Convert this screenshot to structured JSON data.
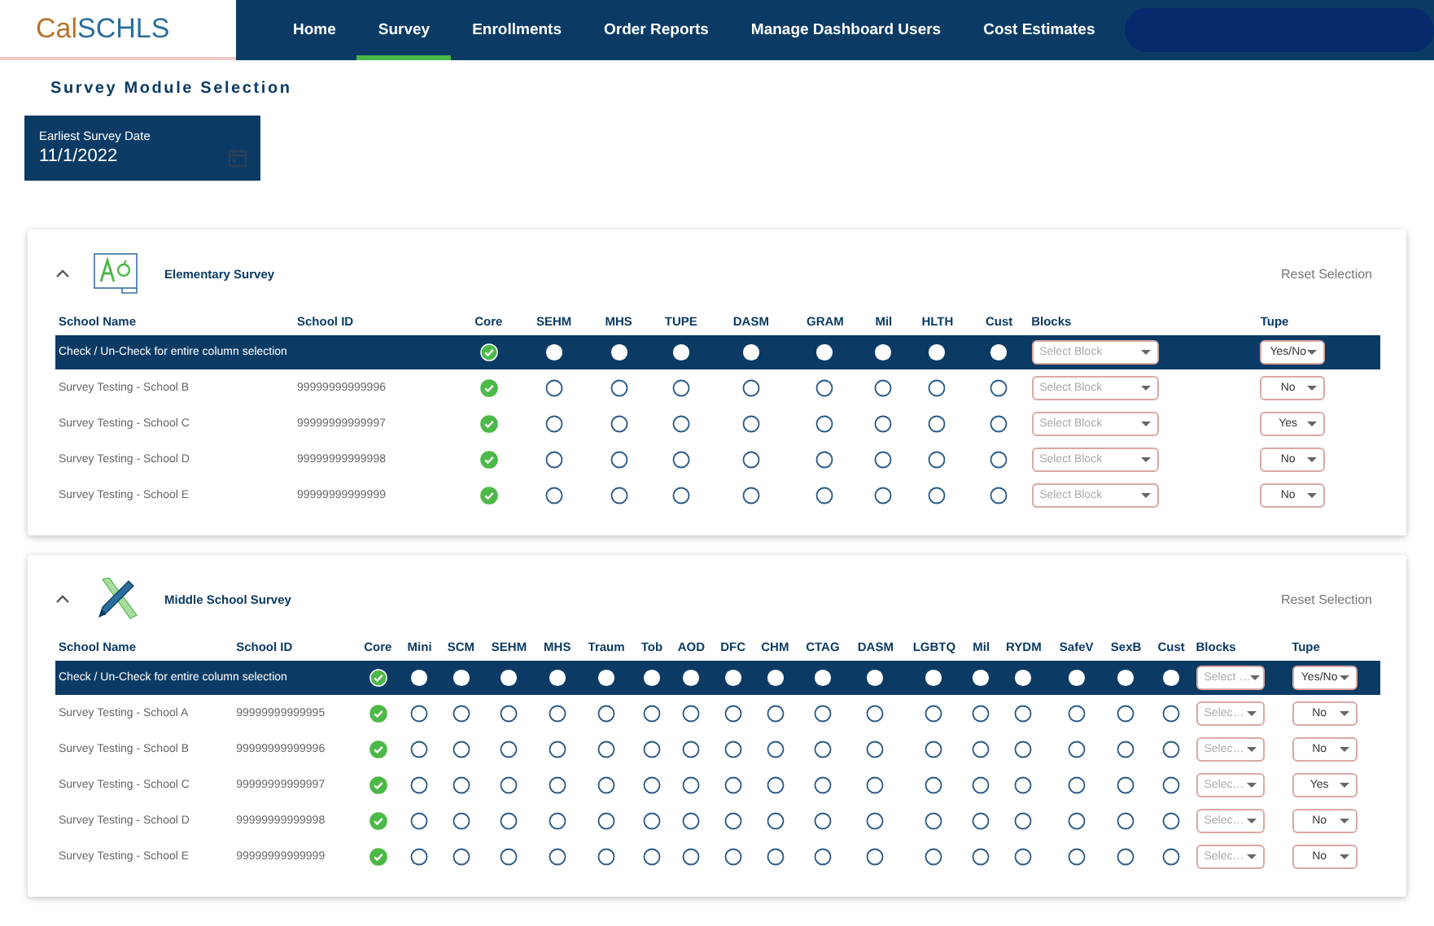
{
  "logo": {
    "part_1": "Cal",
    "part_2": "SCHLS"
  },
  "nav": [
    {
      "label": "Home",
      "selected": false
    },
    {
      "label": "Survey",
      "selected": true
    },
    {
      "label": "Enrollments",
      "selected": false
    },
    {
      "label": "Order Reports",
      "selected": false
    },
    {
      "label": "Manage Dashboard Users",
      "selected": false
    },
    {
      "label": "Cost Estimates",
      "selected": false
    }
  ],
  "page_title": "Survey Module Selection",
  "date_field": {
    "label": "Earliest Survey Date",
    "value": "11/1/2022"
  },
  "surveys": [
    {
      "title": "Elementary Survey",
      "expanded": true,
      "reset": "Reset Selection",
      "columns": {
        "name": "School Name",
        "id": "School ID",
        "modules": [
          "Core",
          "SEHM",
          "MHS",
          "TUPE",
          "DASM",
          "GRAM",
          "Mil",
          "HLTH",
          "Cust"
        ],
        "blocks": "Blocks",
        "tupe": "Tupe"
      },
      "all_row": {
        "label": "Check / Un-Check for entire column selection",
        "checks": [
          {
            "checked": true
          },
          {
            "checked": false
          },
          {
            "checked": false
          },
          {
            "checked": false
          },
          {
            "checked": false
          },
          {
            "checked": false
          },
          {
            "checked": false
          },
          {
            "checked": false
          },
          {
            "checked": false
          }
        ],
        "blocks_placeholder": "Select Block",
        "tupe": "Yes/No"
      },
      "rows": [
        {
          "name": "Survey Testing - School B",
          "id": "99999999999996",
          "checks": [
            {
              "checked": true
            },
            {
              "checked": false
            },
            {
              "checked": false
            },
            {
              "checked": false
            },
            {
              "checked": false
            },
            {
              "checked": false
            },
            {
              "checked": false
            },
            {
              "checked": false
            },
            {
              "checked": false
            }
          ],
          "blocks_placeholder": "Select Block",
          "tupe": "No"
        },
        {
          "name": "Survey Testing - School C",
          "id": "99999999999997",
          "checks": [
            {
              "checked": true
            },
            {
              "checked": false
            },
            {
              "checked": false
            },
            {
              "checked": false
            },
            {
              "checked": false
            },
            {
              "checked": false
            },
            {
              "checked": false
            },
            {
              "checked": false
            },
            {
              "checked": false
            }
          ],
          "blocks_placeholder": "Select Block",
          "tupe": "Yes"
        },
        {
          "name": "Survey Testing - School D",
          "id": "99999999999998",
          "checks": [
            {
              "checked": true
            },
            {
              "checked": false
            },
            {
              "checked": false
            },
            {
              "checked": false
            },
            {
              "checked": false
            },
            {
              "checked": false
            },
            {
              "checked": false
            },
            {
              "checked": false
            },
            {
              "checked": false
            }
          ],
          "blocks_placeholder": "Select Block",
          "tupe": "No"
        },
        {
          "name": "Survey Testing - School E",
          "id": "99999999999999",
          "checks": [
            {
              "checked": true
            },
            {
              "checked": false
            },
            {
              "checked": false
            },
            {
              "checked": false
            },
            {
              "checked": false
            },
            {
              "checked": false
            },
            {
              "checked": false
            },
            {
              "checked": false
            },
            {
              "checked": false
            }
          ],
          "blocks_placeholder": "Select Block",
          "tupe": "No"
        }
      ]
    },
    {
      "title": "Middle School Survey",
      "expanded": true,
      "reset": "Reset Selection",
      "columns": {
        "name": "School Name",
        "id": "School ID",
        "modules": [
          "Core",
          "Mini",
          "SCM",
          "SEHM",
          "MHS",
          "Traum",
          "Tob",
          "AOD",
          "DFC",
          "CHM",
          "CTAG",
          "DASM",
          "LGBTQ",
          "Mil",
          "RYDM",
          "SafeV",
          "SexB",
          "Cust"
        ],
        "blocks": "Blocks",
        "tupe": "Tupe"
      },
      "all_row": {
        "label": "Check / Un-Check for entire column selection",
        "checks": [
          {
            "checked": true
          },
          {
            "checked": false
          },
          {
            "checked": false
          },
          {
            "checked": false
          },
          {
            "checked": false
          },
          {
            "checked": false
          },
          {
            "checked": false
          },
          {
            "checked": false
          },
          {
            "checked": false
          },
          {
            "checked": false
          },
          {
            "checked": false
          },
          {
            "checked": false
          },
          {
            "checked": false
          },
          {
            "checked": false
          },
          {
            "checked": false
          },
          {
            "checked": false
          },
          {
            "checked": false
          },
          {
            "checked": false
          }
        ],
        "blocks_placeholder": "Select …",
        "tupe": "Yes/No"
      },
      "rows": [
        {
          "name": "Survey Testing - School A",
          "id": "99999999999995",
          "checks": [
            {
              "checked": true
            },
            {
              "checked": false
            },
            {
              "checked": false
            },
            {
              "checked": false
            },
            {
              "checked": false
            },
            {
              "checked": false
            },
            {
              "checked": false
            },
            {
              "checked": false
            },
            {
              "checked": false
            },
            {
              "checked": false
            },
            {
              "checked": false
            },
            {
              "checked": false
            },
            {
              "checked": false
            },
            {
              "checked": false
            },
            {
              "checked": false
            },
            {
              "checked": false
            },
            {
              "checked": false
            },
            {
              "checked": false
            }
          ],
          "blocks_placeholder": "Selec…",
          "tupe": "No"
        },
        {
          "name": "Survey Testing - School B",
          "id": "99999999999996",
          "checks": [
            {
              "checked": true
            },
            {
              "checked": false
            },
            {
              "checked": false
            },
            {
              "checked": false
            },
            {
              "checked": false
            },
            {
              "checked": false
            },
            {
              "checked": false
            },
            {
              "checked": false
            },
            {
              "checked": false
            },
            {
              "checked": false
            },
            {
              "checked": false
            },
            {
              "checked": false
            },
            {
              "checked": false
            },
            {
              "checked": false
            },
            {
              "checked": false
            },
            {
              "checked": false
            },
            {
              "checked": false
            },
            {
              "checked": false
            }
          ],
          "blocks_placeholder": "Selec…",
          "tupe": "No"
        },
        {
          "name": "Survey Testing - School C",
          "id": "99999999999997",
          "checks": [
            {
              "checked": true
            },
            {
              "checked": false
            },
            {
              "checked": false
            },
            {
              "checked": false
            },
            {
              "checked": false
            },
            {
              "checked": false
            },
            {
              "checked": false
            },
            {
              "checked": false
            },
            {
              "checked": false
            },
            {
              "checked": false
            },
            {
              "checked": false
            },
            {
              "checked": false
            },
            {
              "checked": false
            },
            {
              "checked": false
            },
            {
              "checked": false
            },
            {
              "checked": false
            },
            {
              "checked": false
            },
            {
              "checked": false
            }
          ],
          "blocks_placeholder": "Selec…",
          "tupe": "Yes"
        },
        {
          "name": "Survey Testing - School D",
          "id": "99999999999998",
          "checks": [
            {
              "checked": true
            },
            {
              "checked": false
            },
            {
              "checked": false
            },
            {
              "checked": false
            },
            {
              "checked": false
            },
            {
              "checked": false
            },
            {
              "checked": false
            },
            {
              "checked": false
            },
            {
              "checked": false
            },
            {
              "checked": false
            },
            {
              "checked": false
            },
            {
              "checked": false
            },
            {
              "checked": false
            },
            {
              "checked": false
            },
            {
              "checked": false
            },
            {
              "checked": false
            },
            {
              "checked": false
            },
            {
              "checked": false
            }
          ],
          "blocks_placeholder": "Selec…",
          "tupe": "No"
        },
        {
          "name": "Survey Testing - School E",
          "id": "99999999999999",
          "checks": [
            {
              "checked": true
            },
            {
              "checked": false
            },
            {
              "checked": false
            },
            {
              "checked": false
            },
            {
              "checked": false
            },
            {
              "checked": false
            },
            {
              "checked": false
            },
            {
              "checked": false
            },
            {
              "checked": false
            },
            {
              "checked": false
            },
            {
              "checked": false
            },
            {
              "checked": false
            },
            {
              "checked": false
            },
            {
              "checked": false
            },
            {
              "checked": false
            },
            {
              "checked": false
            },
            {
              "checked": false
            },
            {
              "checked": false
            }
          ],
          "blocks_placeholder": "Selec…",
          "tupe": "No"
        }
      ]
    }
  ]
}
